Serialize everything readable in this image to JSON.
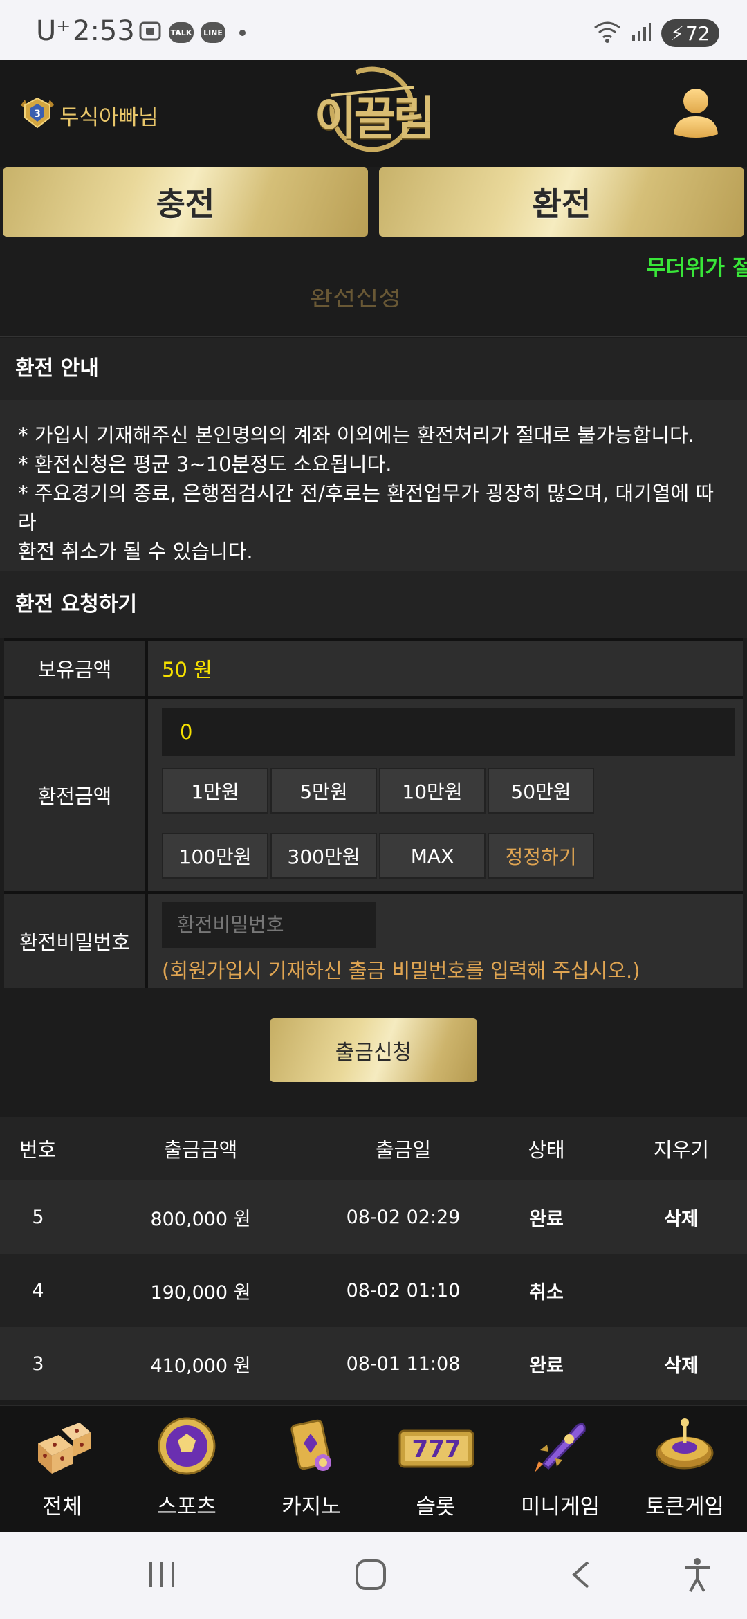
{
  "status_bar": {
    "carrier": "U⁺",
    "time": "2:53",
    "icons": [
      "screenshot-icon",
      "talk-icon",
      "line-icon"
    ],
    "talk": "TALK",
    "line": "LINE",
    "battery": "72"
  },
  "header": {
    "username": "두식아빠님",
    "logo": "이끌림"
  },
  "top_buttons": {
    "charge": "충전",
    "exchange": "환전"
  },
  "marquee": "무더위가 절",
  "ghost_text": "환전신청",
  "notice_section": {
    "title": "환전 안내",
    "lines": [
      "* 가입시 기재해주신 본인명의의 계좌 이외에는 환전처리가 절대로 불가능합니다.",
      "* 환전신청은 평균 3~10분정도 소요됩니다.",
      "* 주요경기의 종료, 은행점검시간 전/후로는 환전업무가 굉장히 많으며, 대기열에 따라",
      "환전 취소가 될 수 있습니다."
    ]
  },
  "request_section": {
    "title": "환전 요청하기",
    "balance_label": "보유금액",
    "balance_value": "50 원",
    "amount_label": "환전금액",
    "amount_value": "0",
    "chips": [
      "1만원",
      "5만원",
      "10만원",
      "50만원",
      "100만원",
      "300만원",
      "MAX",
      "정정하기"
    ],
    "password_label": "환전비밀번호",
    "password_placeholder": "환전비밀번호",
    "password_hint": "(회원가입시 기재하신 출금 비밀번호를 입력해 주십시오.)",
    "submit": "출금신청"
  },
  "history": {
    "headers": [
      "번호",
      "출금금액",
      "출금일",
      "상태",
      "지우기"
    ],
    "rows": [
      {
        "no": "5",
        "amount": "800,000 원",
        "date": "08-02 02:29",
        "status": "완료",
        "delete": "삭제"
      },
      {
        "no": "4",
        "amount": "190,000 원",
        "date": "08-02 01:10",
        "status": "취소",
        "delete": ""
      },
      {
        "no": "3",
        "amount": "410,000 원",
        "date": "08-01 11:08",
        "status": "완료",
        "delete": "삭제"
      }
    ]
  },
  "bottom_nav": [
    {
      "label": "전체",
      "icon": "dice-icon"
    },
    {
      "label": "스포츠",
      "icon": "soccer-ball-icon"
    },
    {
      "label": "카지노",
      "icon": "playing-cards-icon"
    },
    {
      "label": "슬롯",
      "icon": "slot-777-icon"
    },
    {
      "label": "미니게임",
      "icon": "rocket-icon"
    },
    {
      "label": "토큰게임",
      "icon": "roulette-icon"
    }
  ],
  "colors": {
    "gold": "#e8c66a",
    "yellow_value": "#f5e000",
    "orange_hint": "#e0a552",
    "marquee_green": "#39e639",
    "background": "#1c1c1c"
  }
}
